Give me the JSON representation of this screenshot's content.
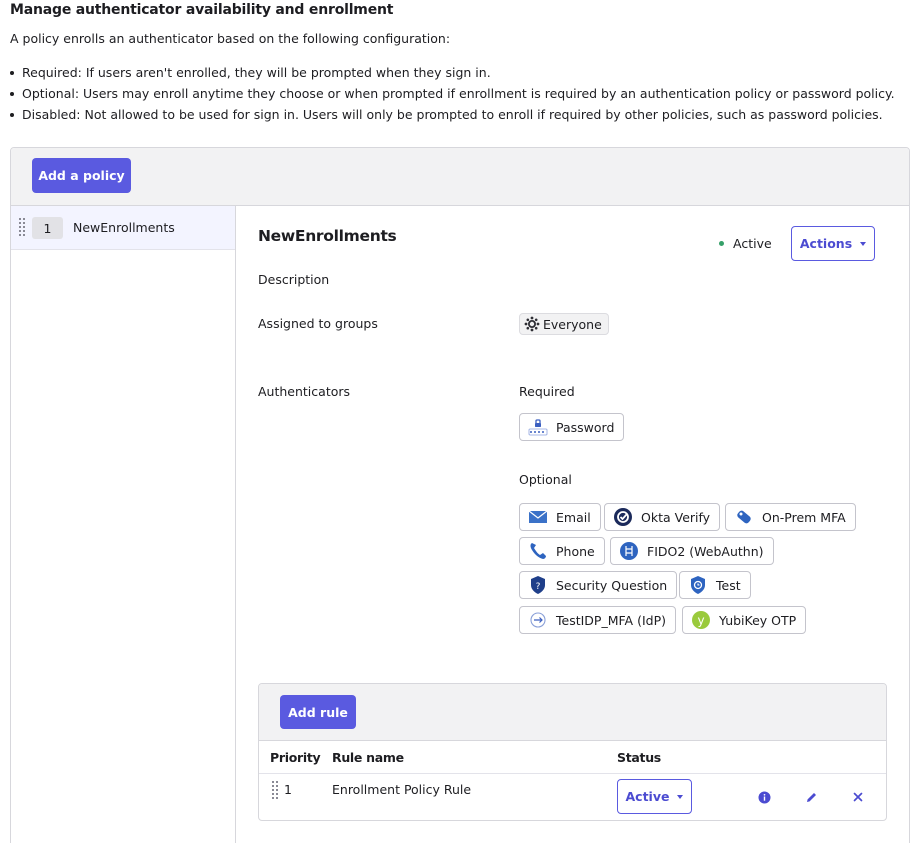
{
  "page": {
    "heading": "Manage authenticator availability and enrollment",
    "intro": "A policy enrolls an authenticator based on the following configuration:",
    "bullets": [
      "Required: If users aren't enrolled, they will be prompted when they sign in.",
      "Optional: Users may enroll anytime they choose or when prompted if enrollment is required by an authentication policy or password policy.",
      "Disabled: Not allowed to be used for sign in. Users will only be prompted to enroll if required by other policies, such as password policies."
    ]
  },
  "toolbar": {
    "add_policy_label": "Add a policy"
  },
  "policies": [
    {
      "priority": "1",
      "name": "NewEnrollments"
    }
  ],
  "detail": {
    "title": "NewEnrollments",
    "status": "Active",
    "status_color": "#36a069",
    "actions_label": "Actions",
    "description_label": "Description",
    "assigned_label": "Assigned to groups",
    "group": {
      "name": "Everyone",
      "icon": "group-everyone-icon"
    },
    "authenticators_label": "Authenticators",
    "required_label": "Required",
    "required": [
      {
        "name": "Password",
        "icon": "password-icon"
      }
    ],
    "optional_label": "Optional",
    "optional": [
      {
        "name": "Email",
        "icon": "email-icon"
      },
      {
        "name": "Okta Verify",
        "icon": "okta-verify-icon"
      },
      {
        "name": "On-Prem MFA",
        "icon": "on-prem-mfa-icon"
      },
      {
        "name": "Phone",
        "icon": "phone-icon"
      },
      {
        "name": "FIDO2 (WebAuthn)",
        "icon": "fido2-icon"
      },
      {
        "name": "Security Question",
        "icon": "security-question-icon"
      },
      {
        "name": "Test",
        "icon": "test-authenticator-icon"
      },
      {
        "name": "TestIDP_MFA (IdP)",
        "icon": "idp-icon"
      },
      {
        "name": "YubiKey OTP",
        "icon": "yubikey-icon"
      }
    ]
  },
  "rules": {
    "add_rule_label": "Add rule",
    "columns": {
      "priority": "Priority",
      "name": "Rule name",
      "status": "Status"
    },
    "rows": [
      {
        "priority": "1",
        "name": "Enrollment Policy Rule",
        "status": "Active"
      }
    ]
  },
  "colors": {
    "primary": "#5a5ae0",
    "primary_text": "#4b4bd1",
    "panel_bg": "#f2f2f3",
    "selected_bg": "#f3f4ff"
  }
}
